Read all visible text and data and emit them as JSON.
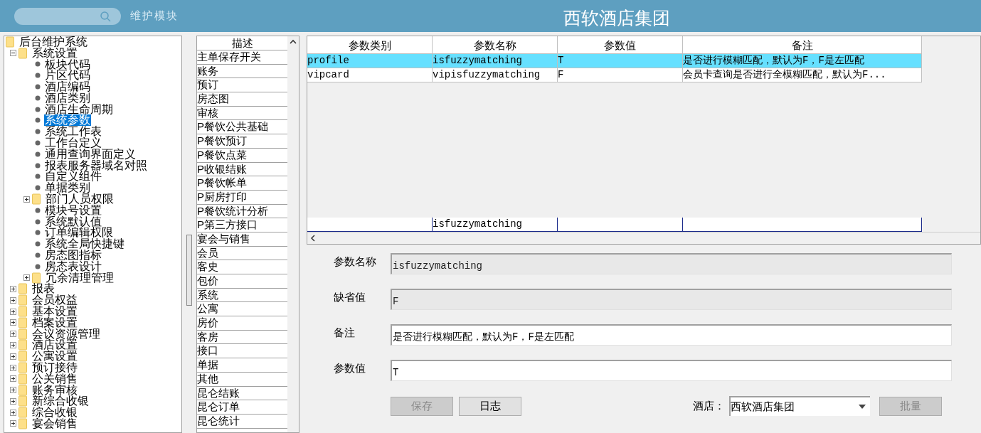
{
  "header": {
    "module_label": "维护模块",
    "title": "西软酒店集团"
  },
  "tree": [
    {
      "label": "后台维护系统",
      "kind": "folder",
      "selected": false,
      "children": [
        {
          "label": "系统设置",
          "kind": "folder",
          "expanded": true,
          "selected": false,
          "children": [
            {
              "label": "板块代码",
              "kind": "leaf",
              "selected": false
            },
            {
              "label": "片区代码",
              "kind": "leaf",
              "selected": false
            },
            {
              "label": "酒店编码",
              "kind": "leaf",
              "selected": false
            },
            {
              "label": "酒店类别",
              "kind": "leaf",
              "selected": false
            },
            {
              "label": "酒店生命周期",
              "kind": "leaf",
              "selected": false
            },
            {
              "label": "系统参数",
              "kind": "leaf",
              "selected": true
            },
            {
              "label": "系统工作表",
              "kind": "leaf",
              "selected": false
            },
            {
              "label": "工作台定义",
              "kind": "leaf",
              "selected": false
            },
            {
              "label": "通用查询界面定义",
              "kind": "leaf",
              "selected": false
            },
            {
              "label": "报表服务器域名对照",
              "kind": "leaf",
              "selected": false
            },
            {
              "label": "自定义组件",
              "kind": "leaf",
              "selected": false
            },
            {
              "label": "单据类别",
              "kind": "leaf",
              "selected": false
            },
            {
              "label": "部门人员权限",
              "kind": "folder",
              "expanded": false,
              "selected": false
            },
            {
              "label": "模块号设置",
              "kind": "leaf",
              "selected": false
            },
            {
              "label": "系统默认值",
              "kind": "leaf",
              "selected": false
            },
            {
              "label": "订单编辑权限",
              "kind": "leaf",
              "selected": false
            },
            {
              "label": "系统全局快捷键",
              "kind": "leaf",
              "selected": false
            },
            {
              "label": "房态图指标",
              "kind": "leaf",
              "selected": false
            },
            {
              "label": "房态表设计",
              "kind": "leaf",
              "selected": false
            },
            {
              "label": "冗余清理管理",
              "kind": "folder",
              "expanded": false,
              "selected": false
            }
          ]
        },
        {
          "label": "报表",
          "kind": "folder",
          "expanded": false,
          "selected": false
        },
        {
          "label": "会员权益",
          "kind": "folder",
          "expanded": false,
          "selected": false
        },
        {
          "label": "基本设置",
          "kind": "folder",
          "expanded": false,
          "selected": false
        },
        {
          "label": "档案设置",
          "kind": "folder",
          "expanded": false,
          "selected": false
        },
        {
          "label": "会议资源管理",
          "kind": "folder",
          "expanded": false,
          "selected": false
        },
        {
          "label": "酒店设置",
          "kind": "folder",
          "expanded": false,
          "selected": false
        },
        {
          "label": "公寓设置",
          "kind": "folder",
          "expanded": false,
          "selected": false
        },
        {
          "label": "预订接待",
          "kind": "folder",
          "expanded": false,
          "selected": false
        },
        {
          "label": "公关销售",
          "kind": "folder",
          "expanded": false,
          "selected": false
        },
        {
          "label": "账务审核",
          "kind": "folder",
          "expanded": false,
          "selected": false
        },
        {
          "label": "新综合收银",
          "kind": "folder",
          "expanded": false,
          "selected": false
        },
        {
          "label": "综合收银",
          "kind": "folder",
          "expanded": false,
          "selected": false
        },
        {
          "label": "宴会销售",
          "kind": "folder",
          "expanded": false,
          "selected": false
        }
      ]
    }
  ],
  "description_list": {
    "column": "描述",
    "items": [
      "主单保存开关",
      "账务",
      "预订",
      "房态图",
      "审核",
      "P餐饮公共基础",
      "P餐饮预订",
      "P餐饮点菜",
      "P收银结账",
      "P餐饮帐单",
      "P厨房打印",
      "P餐饮统计分析",
      "P第三方接口",
      "宴会与销售",
      "会员",
      "客史",
      "包价",
      "系统",
      "公寓",
      "房价",
      "客房",
      "接口",
      "单据",
      "其他",
      "昆仑结账",
      "昆仑订单",
      "昆仑统计"
    ]
  },
  "table": {
    "columns": [
      "参数类别",
      "参数名称",
      "参数值",
      "备注"
    ],
    "rows": [
      {
        "cells": [
          "profile",
          "isfuzzymatching",
          "T",
          "是否进行模糊匹配，默认为F，F是左匹配"
        ],
        "selected": true
      },
      {
        "cells": [
          "vipcard",
          "vipisfuzzymatching",
          "F",
          "会员卡查询是否进行全模糊匹配，默认为F..."
        ],
        "selected": false
      }
    ],
    "summary_row": {
      "column_2": "isfuzzymatching"
    }
  },
  "form": {
    "fields": [
      {
        "label": "参数名称",
        "value": "isfuzzymatching",
        "readonly": true
      },
      {
        "label": "缺省值",
        "value": "F",
        "readonly": true
      },
      {
        "label": "备注",
        "value": "是否进行模糊匹配，默认为F，F是左匹配",
        "readonly": false
      },
      {
        "label": "参数值",
        "value": "T",
        "readonly": false
      }
    ],
    "buttons": [
      {
        "label": "保存",
        "disabled": true
      },
      {
        "label": "日志",
        "disabled": false
      }
    ],
    "hotel": {
      "label": "酒店：",
      "value": "西软酒店集团"
    },
    "batch_button": {
      "label": "批量",
      "disabled": true
    }
  }
}
